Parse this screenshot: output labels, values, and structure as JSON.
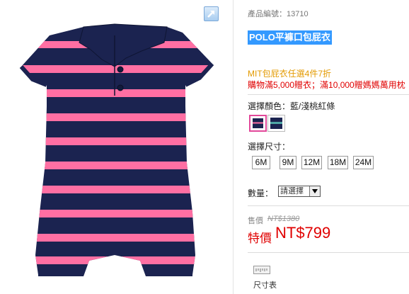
{
  "product": {
    "number_label": "產品編號：13710",
    "title": "POLO平褲口包屁衣"
  },
  "promotions": [
    "MIT包屁衣任選4件7折",
    "購物滿5,000贈衣；滿10,000贈媽媽萬用枕"
  ],
  "color": {
    "label": "選擇顏色：藍/淺桃紅條",
    "swatches": [
      {
        "name": "navy-pink",
        "selected": true
      },
      {
        "name": "navy-teal",
        "selected": false
      }
    ]
  },
  "size": {
    "label": "選擇尺寸：",
    "options": [
      "6M",
      "9M",
      "12M",
      "18M",
      "24M"
    ]
  },
  "quantity": {
    "label": "數量：",
    "selected": "請選擇"
  },
  "price": {
    "label": "售價",
    "original": "NT$1380",
    "special_label": "特價",
    "special": "NT$799"
  },
  "size_chart": {
    "label": "尺寸表"
  },
  "colors": {
    "accent_pink": "#e2489a",
    "sale_red": "#e00000",
    "promo_orange": "#e39a00",
    "title_bg": "#3399ff",
    "garment_navy": "#1b2350",
    "garment_pink": "#ff6fa3"
  }
}
